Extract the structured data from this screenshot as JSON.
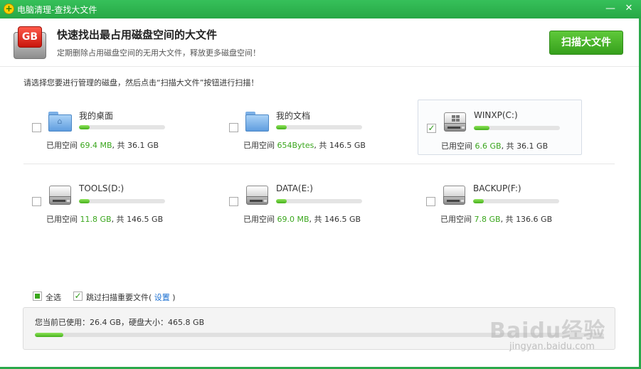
{
  "window": {
    "title": "电脑清理-查找大文件",
    "minimize_glyph": "—",
    "close_glyph": "✕",
    "app_icon_glyph": "+"
  },
  "header": {
    "logo_text": "GB",
    "title": "快速找出最占用磁盘空间的大文件",
    "subtitle": "定期删除占用磁盘空间的无用大文件，释放更多磁盘空间！",
    "scan_button": "扫描大文件"
  },
  "instruction": "请选择您要进行管理的磁盘，然后点击“扫描大文件”按钮进行扫描！",
  "drives": [
    {
      "name": "我的桌面",
      "icon": "desktop-folder-icon",
      "used_label": "已用空间",
      "used": "69.4 MB",
      "total_prefix": ", 共",
      "total": "36.1 GB",
      "fill_fraction": 0.12,
      "checked": false
    },
    {
      "name": "我的文档",
      "icon": "documents-folder-icon",
      "used_label": "已用空间",
      "used": "654Bytes",
      "total_prefix": ", 共",
      "total": "146.5 GB",
      "fill_fraction": 0.12,
      "checked": false
    },
    {
      "name": "WINXP(C:)",
      "icon": "system-drive-icon",
      "used_label": "已用空间",
      "used": "6.6 GB",
      "total_prefix": ", 共",
      "total": "36.1 GB",
      "fill_fraction": 0.18,
      "checked": true,
      "check_glyph": "✓"
    },
    {
      "name": "TOOLS(D:)",
      "icon": "hard-drive-icon",
      "used_label": "已用空间",
      "used": "11.8 GB",
      "total_prefix": ", 共",
      "total": "146.5 GB",
      "fill_fraction": 0.12,
      "checked": false
    },
    {
      "name": "DATA(E:)",
      "icon": "hard-drive-icon",
      "used_label": "已用空间",
      "used": "69.0 MB",
      "total_prefix": ", 共",
      "total": "146.5 GB",
      "fill_fraction": 0.12,
      "checked": false
    },
    {
      "name": "BACKUP(F:)",
      "icon": "hard-drive-icon",
      "used_label": "已用空间",
      "used": "7.8 GB",
      "total_prefix": ", 共",
      "total": "136.6 GB",
      "fill_fraction": 0.12,
      "checked": false
    }
  ],
  "options": {
    "select_all": "全选",
    "skip_important": "跳过扫描重要文件(",
    "settings_link": "设置",
    "close_paren": ")",
    "check_glyph": "✓"
  },
  "total": {
    "text": "您当前已使用：26.4 GB，硬盘大小：465.8 GB",
    "fill_fraction": 0.05
  },
  "watermark": {
    "main": "Baidu经验",
    "sub": "jingyan.baidu.com"
  },
  "colors": {
    "title_bar": "#27a845",
    "accent_green": "#3aa61d",
    "link_blue": "#1a6fd1"
  }
}
